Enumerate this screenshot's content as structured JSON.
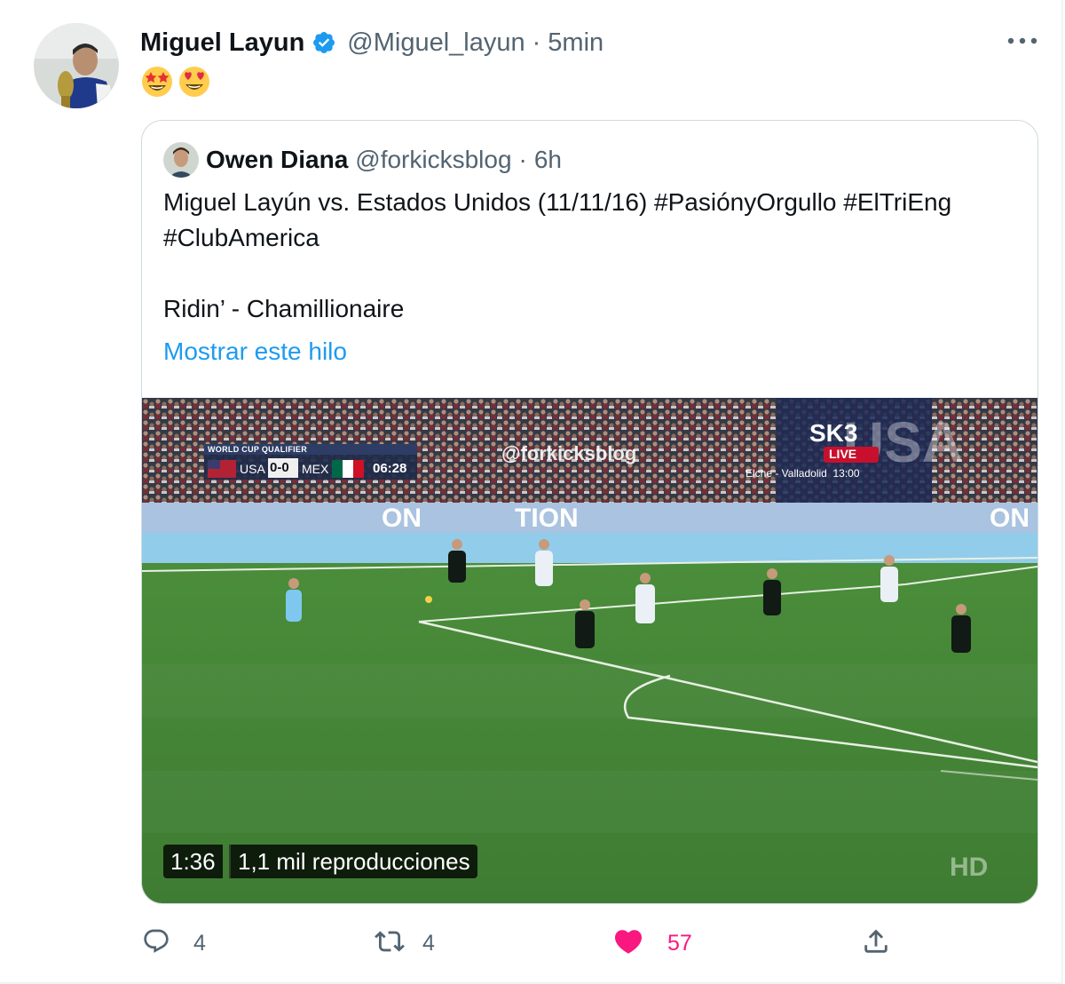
{
  "tweet": {
    "author_name": "Miguel Layun",
    "author_handle": "@Miguel_layun",
    "separator": "·",
    "time": "5min",
    "emojis": [
      "star-struck",
      "heart-eyes"
    ]
  },
  "quoted": {
    "author_name": "Owen Diana",
    "author_handle": "@forkicksblog",
    "separator": "·",
    "time": "6h",
    "text_line1": "Miguel Layún vs. Estados Unidos (11/11/16) #PasiónyOrgullo #ElTriEng",
    "text_line2": "#ClubAmerica",
    "text_line3": "Ridin’ - Chamillionaire",
    "show_thread": "Mostrar este hilo",
    "video": {
      "scoreboard_title": "WORLD CUP QUALIFIER",
      "team_home": "USA",
      "score": "0-0",
      "team_away": "MEX",
      "clock": "06:28",
      "watermark": "@forkicksblog",
      "channel_logo": "SK3",
      "live_label": "LIVE",
      "ticker": "Elche - Valladolid  13:00",
      "hd_label": "HD",
      "duration": "1:36",
      "views": "1,1 mil reproducciones"
    }
  },
  "actions": {
    "reply_count": "4",
    "retweet_count": "4",
    "like_count": "57"
  },
  "colors": {
    "accent": "#1d9bf0",
    "like": "#f91880",
    "muted": "#536471",
    "border": "#cfd9de"
  }
}
